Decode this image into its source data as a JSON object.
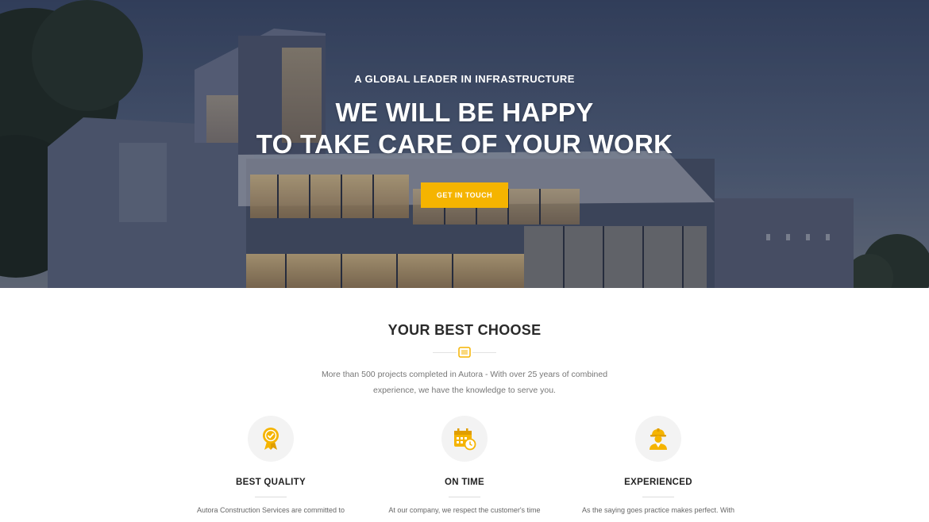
{
  "hero": {
    "kicker": "A GLOBAL LEADER IN INFRASTRUCTURE",
    "title_line1": "WE WILL BE HAPPY",
    "title_line2": "TO TAKE CARE OF YOUR WORK",
    "cta_label": "GET IN TOUCH"
  },
  "section": {
    "title": "YOUR BEST CHOOSE",
    "description": "More than 500 projects completed in Autora - With over 25 years of combined experience, we have the knowledge to serve you."
  },
  "features": [
    {
      "title": "BEST QUALITY",
      "text": "Autora Construction Services are committed to",
      "icon": "award-medal-icon"
    },
    {
      "title": "ON TIME",
      "text": "At our company, we respect the customer's time",
      "icon": "calendar-clock-icon"
    },
    {
      "title": "EXPERIENCED",
      "text": "As the saying goes practice makes perfect. With",
      "icon": "construction-worker-icon"
    }
  ],
  "colors": {
    "accent": "#f5b400",
    "heading": "#2a2a2a",
    "body_text": "#777777"
  }
}
